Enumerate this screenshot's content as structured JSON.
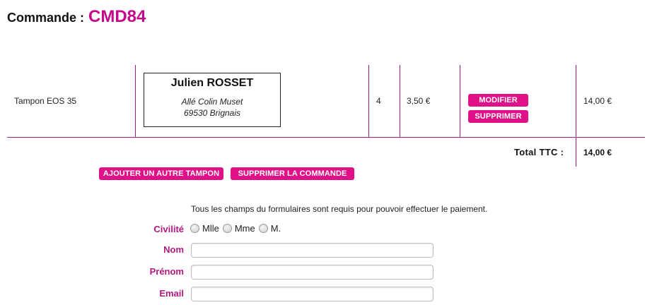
{
  "header": {
    "label": "Commande :",
    "order_code": "CMD84"
  },
  "order": {
    "item": {
      "product": "Tampon EOS 35",
      "recipient": {
        "name": "Julien ROSSET",
        "address_line1": "Allé Colin Muset",
        "address_line2": "69530 Brignais"
      },
      "quantity": "4",
      "unit_price": "3,50 €",
      "modify_label": "MODIFIER",
      "delete_label": "SUPPRIMER",
      "line_total": "14,00 €"
    },
    "total_label": "Total TTC :",
    "total_value": "14,00 €"
  },
  "actions": {
    "add_label": "AJOUTER UN AUTRE TAMPON",
    "delete_order_label": "SUPPRIMER LA COMMANDE"
  },
  "form": {
    "notice": "Tous les champs du formulaires sont requis pour pouvoir effectuer le paiement.",
    "civility": {
      "label": "Civilité",
      "options": [
        "Mlle",
        "Mme",
        "M."
      ]
    },
    "nom": {
      "label": "Nom",
      "value": ""
    },
    "prenom": {
      "label": "Prénom",
      "value": ""
    },
    "email": {
      "label": "Email",
      "value": ""
    }
  },
  "colors": {
    "accent": "#e01089",
    "title_accent": "#c5088a",
    "label": "#b0197f",
    "rule": "#a01a80"
  }
}
